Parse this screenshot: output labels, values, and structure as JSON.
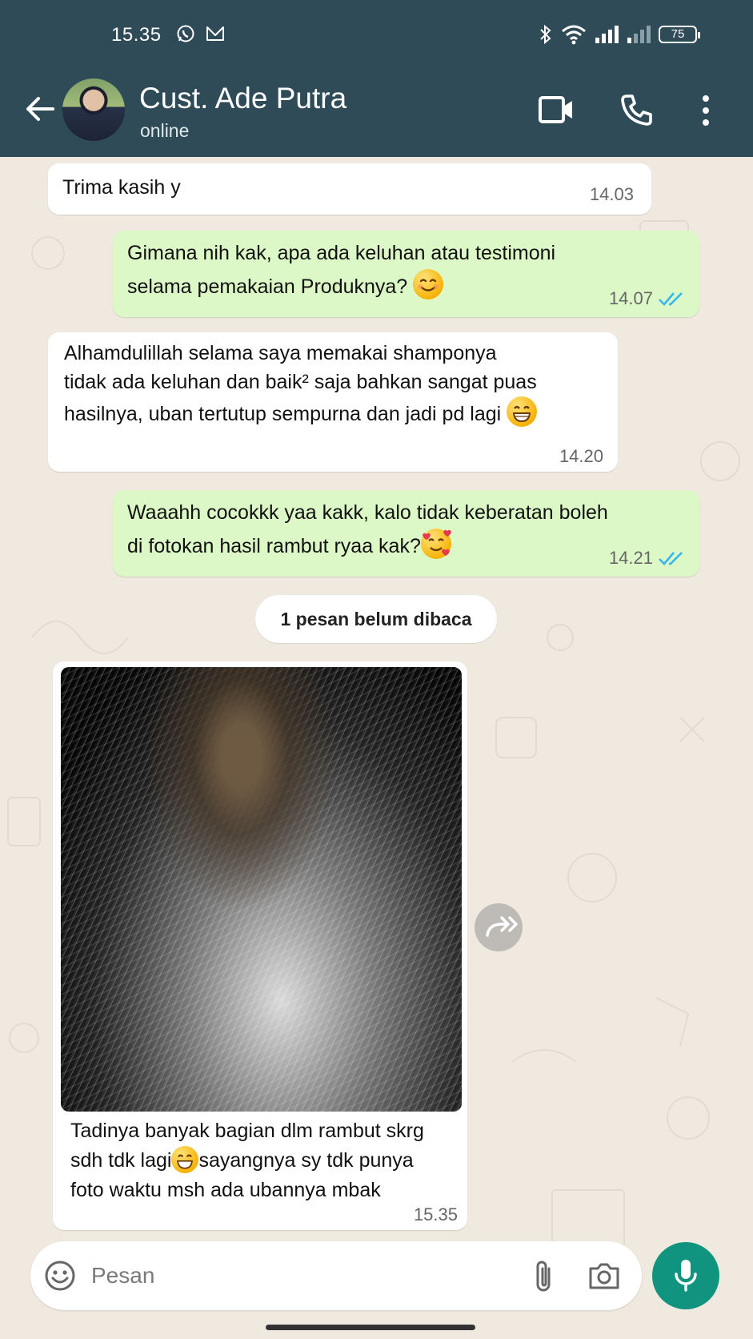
{
  "status_bar": {
    "time": "15.35",
    "battery": "75",
    "icons": [
      "whatsapp-icon",
      "mail-icon",
      "bluetooth-icon",
      "wifi-icon",
      "signal-icon",
      "signal-icon"
    ]
  },
  "header": {
    "contact_name": "Cust. Ade Putra",
    "contact_status": "online",
    "icons": [
      "back-arrow-icon",
      "video-call-icon",
      "phone-icon",
      "more-vert-icon"
    ]
  },
  "colors": {
    "header": "#2e4b57",
    "outgoing": "#dcf8c6",
    "incoming": "#ffffff",
    "accent": "#11947f",
    "tick_read": "#34b7f1"
  },
  "messages": [
    {
      "direction": "in",
      "text": "Trima kasih y",
      "time": "14.03"
    },
    {
      "direction": "out",
      "lines": [
        "Gimana nih kak, apa ada keluhan atau testimoni",
        "selama pemakaian Produknya?"
      ],
      "emoji": "smiling-face",
      "time": "14.07",
      "status": "read"
    },
    {
      "direction": "in",
      "lines": [
        "Alhamdulillah selama saya memakai shamponya",
        "tidak ada keluhan dan baik² saja bahkan sangat puas",
        "hasilnya, uban tertutup sempurna dan jadi pd lagi"
      ],
      "emoji": "grinning-face",
      "time": "14.20"
    },
    {
      "direction": "out",
      "lines": [
        "Waaahh cocokkk yaa kakk, kalo tidak keberatan boleh",
        "di fotokan hasil rambut ryaa kak?"
      ],
      "emoji": "smiling-face-with-hearts",
      "time": "14.21",
      "status": "read"
    },
    {
      "direction": "in",
      "type": "image",
      "lines": [
        "Tadinya banyak bagian dlm rambut skrg",
        "sdh tdk lagi",
        "sayangnya sy tdk punya",
        "foto waktu msh ada ubannya mbak"
      ],
      "emoji": "grinning-face",
      "time": "15.35"
    }
  ],
  "unread_divider": "1 pesan belum dibaca",
  "composer": {
    "placeholder": "Pesan",
    "icons": [
      "emoji-icon",
      "attach-icon",
      "camera-icon",
      "mic-icon"
    ]
  }
}
